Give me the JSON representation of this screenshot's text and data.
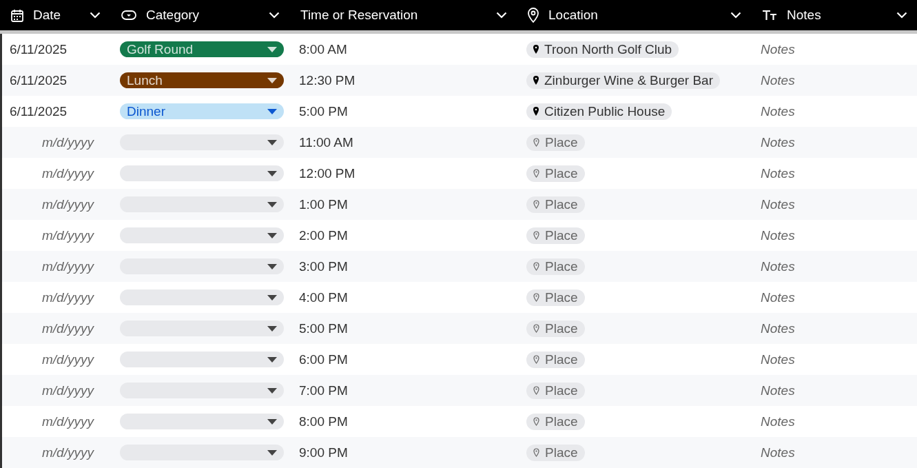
{
  "columns": [
    {
      "kind": "date",
      "label": "Date"
    },
    {
      "kind": "category",
      "label": "Category"
    },
    {
      "kind": "time",
      "label": "Time or Reservation"
    },
    {
      "kind": "location",
      "label": "Location"
    },
    {
      "kind": "notes",
      "label": "Notes"
    }
  ],
  "rows": [
    {
      "date": {
        "value": "6/11/2025"
      },
      "category": {
        "label": "Golf Round",
        "color": "#137a4c"
      },
      "time": "8:00 AM",
      "location": {
        "value": "Troon North Golf Club"
      },
      "notes": {
        "placeholder": "Notes"
      }
    },
    {
      "date": {
        "value": "6/11/2025"
      },
      "category": {
        "label": "Lunch",
        "color": "#753800"
      },
      "time": "12:30 PM",
      "location": {
        "value": "Zinburger Wine & Burger Bar"
      },
      "notes": {
        "placeholder": "Notes"
      }
    },
    {
      "date": {
        "value": "6/11/2025"
      },
      "category": {
        "label": "Dinner",
        "color": "#bfe1f6"
      },
      "time": "5:00 PM",
      "location": {
        "value": "Citizen Public House"
      },
      "notes": {
        "placeholder": "Notes"
      }
    },
    {
      "date": {
        "placeholder": "m/d/yyyy"
      },
      "category": {},
      "time": "11:00 AM",
      "location": {
        "placeholder": "Place"
      },
      "notes": {
        "placeholder": "Notes"
      }
    },
    {
      "date": {
        "placeholder": "m/d/yyyy"
      },
      "category": {},
      "time": "12:00 PM",
      "location": {
        "placeholder": "Place"
      },
      "notes": {
        "placeholder": "Notes"
      }
    },
    {
      "date": {
        "placeholder": "m/d/yyyy"
      },
      "category": {},
      "time": "1:00 PM",
      "location": {
        "placeholder": "Place"
      },
      "notes": {
        "placeholder": "Notes"
      }
    },
    {
      "date": {
        "placeholder": "m/d/yyyy"
      },
      "category": {},
      "time": "2:00 PM",
      "location": {
        "placeholder": "Place"
      },
      "notes": {
        "placeholder": "Notes"
      }
    },
    {
      "date": {
        "placeholder": "m/d/yyyy"
      },
      "category": {},
      "time": "3:00 PM",
      "location": {
        "placeholder": "Place"
      },
      "notes": {
        "placeholder": "Notes"
      }
    },
    {
      "date": {
        "placeholder": "m/d/yyyy"
      },
      "category": {},
      "time": "4:00 PM",
      "location": {
        "placeholder": "Place"
      },
      "notes": {
        "placeholder": "Notes"
      }
    },
    {
      "date": {
        "placeholder": "m/d/yyyy"
      },
      "category": {},
      "time": "5:00 PM",
      "location": {
        "placeholder": "Place"
      },
      "notes": {
        "placeholder": "Notes"
      }
    },
    {
      "date": {
        "placeholder": "m/d/yyyy"
      },
      "category": {},
      "time": "6:00 PM",
      "location": {
        "placeholder": "Place"
      },
      "notes": {
        "placeholder": "Notes"
      }
    },
    {
      "date": {
        "placeholder": "m/d/yyyy"
      },
      "category": {},
      "time": "7:00 PM",
      "location": {
        "placeholder": "Place"
      },
      "notes": {
        "placeholder": "Notes"
      }
    },
    {
      "date": {
        "placeholder": "m/d/yyyy"
      },
      "category": {},
      "time": "8:00 PM",
      "location": {
        "placeholder": "Place"
      },
      "notes": {
        "placeholder": "Notes"
      }
    },
    {
      "date": {
        "placeholder": "m/d/yyyy"
      },
      "category": {},
      "time": "9:00 PM",
      "location": {
        "placeholder": "Place"
      },
      "notes": {
        "placeholder": "Notes"
      }
    }
  ]
}
